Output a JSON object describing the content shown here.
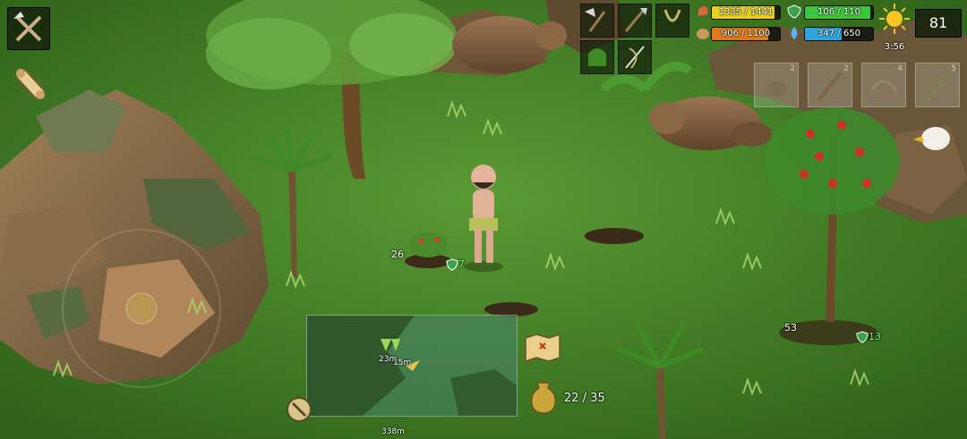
{
  "stats": {
    "health": {
      "text": "1335 / 1441",
      "fraction": 0.926,
      "color": "#e8d21a"
    },
    "hunger": {
      "text": "906 / 1100",
      "fraction": 0.824,
      "color": "#e07a18"
    },
    "armor": {
      "text": "106 / 110",
      "fraction": 0.964,
      "color": "#3cc63a"
    },
    "thirst": {
      "text": "347 / 650",
      "fraction": 0.534,
      "color": "#2aa7e0"
    }
  },
  "clock": {
    "time": "3:56",
    "icon": "sun-icon"
  },
  "day_counter": "81",
  "equipment": {
    "slots": [
      "axe-icon",
      "spear-icon",
      "sling-icon",
      "hat-icon",
      "needle-icon"
    ]
  },
  "crafting_slots": [
    {
      "count": "2",
      "icon": "rock-icon"
    },
    {
      "count": "2",
      "icon": "stick-icon"
    },
    {
      "count": "4",
      "icon": "rope-icon"
    },
    {
      "count": "5",
      "icon": "branch-icon"
    }
  ],
  "world_labels": {
    "bush_count": "26",
    "bush_shield": "7",
    "tree_count": "53",
    "tree_shield": "13"
  },
  "minimap": {
    "label_near": "23m",
    "label_near2": "15m",
    "label_bottom": "338m"
  },
  "inventory": {
    "text": "22 / 35"
  },
  "colors": {
    "grass": "#3f7a26",
    "hud_dark": "#151d0c"
  }
}
